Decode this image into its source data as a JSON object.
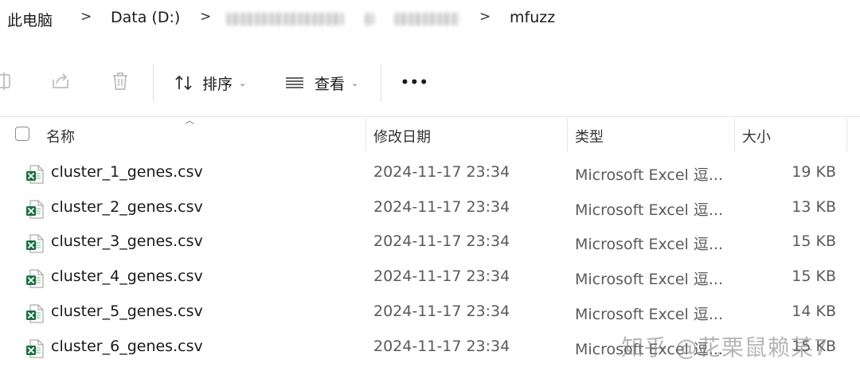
{
  "breadcrumb": {
    "items": [
      "此电脑",
      "Data (D:)",
      "mfuzz"
    ],
    "separator": ">"
  },
  "toolbar": {
    "sort_label": "排序",
    "view_label": "查看",
    "more_label": "•••"
  },
  "columns": {
    "name": "名称",
    "date": "修改日期",
    "type": "类型",
    "size": "大小"
  },
  "files": [
    {
      "name": "cluster_1_genes.csv",
      "date": "2024-11-17 23:34",
      "type": "Microsoft Excel 逗...",
      "size": "19 KB"
    },
    {
      "name": "cluster_2_genes.csv",
      "date": "2024-11-17 23:34",
      "type": "Microsoft Excel 逗...",
      "size": "13 KB"
    },
    {
      "name": "cluster_3_genes.csv",
      "date": "2024-11-17 23:34",
      "type": "Microsoft Excel 逗...",
      "size": "15 KB"
    },
    {
      "name": "cluster_4_genes.csv",
      "date": "2024-11-17 23:34",
      "type": "Microsoft Excel 逗...",
      "size": "15 KB"
    },
    {
      "name": "cluster_5_genes.csv",
      "date": "2024-11-17 23:34",
      "type": "Microsoft Excel 逗...",
      "size": "14 KB"
    },
    {
      "name": "cluster_6_genes.csv",
      "date": "2024-11-17 23:34",
      "type": "Microsoft Excel 逗...",
      "size": "15 KB"
    }
  ],
  "watermark": "知乎 @花栗鼠赖某7",
  "colors": {
    "excel_green": "#1d7044",
    "text_primary": "#1a1a1a",
    "text_secondary": "#5a5a5a"
  }
}
